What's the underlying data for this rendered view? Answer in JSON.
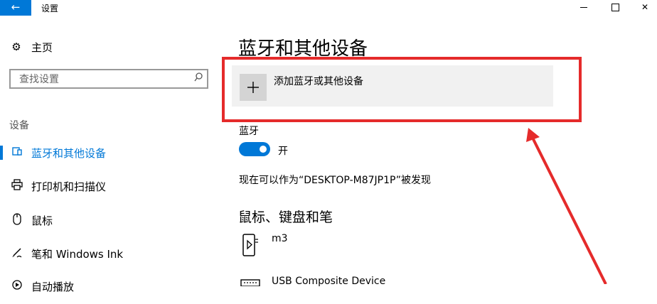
{
  "window": {
    "title": "设置",
    "back_icon": "back-arrow-icon",
    "minimize_icon": "minimize-icon",
    "maximize_icon": "maximize-icon",
    "close_glyph": "✕",
    "accent": "#0078d7"
  },
  "sidebar": {
    "home": {
      "label": "主页",
      "icon": "gear-icon"
    },
    "search": {
      "placeholder": "查找设置",
      "icon": "search-icon"
    },
    "section_label": "设备",
    "items": [
      {
        "label": "蓝牙和其他设备",
        "icon": "bluetooth-devices-icon",
        "active": true
      },
      {
        "label": "打印机和扫描仪",
        "icon": "printer-icon",
        "active": false
      },
      {
        "label": "鼠标",
        "icon": "mouse-icon",
        "active": false
      },
      {
        "label": "笔和 Windows Ink",
        "icon": "pen-icon",
        "active": false
      },
      {
        "label": "自动播放",
        "icon": "autoplay-icon",
        "active": false
      }
    ]
  },
  "main": {
    "title": "蓝牙和其他设备",
    "add_device_label": "添加蓝牙或其他设备",
    "bluetooth": {
      "label": "蓝牙",
      "toggle_state": "开",
      "on": true
    },
    "discoverable_text": "现在可以作为“DESKTOP-M87JP1P”被发现",
    "devices_section_title": "鼠标、键盘和笔",
    "devices": [
      {
        "name": "m3",
        "icon": "phone-device-icon"
      },
      {
        "name": "USB Composite Device",
        "icon": "keyboard-icon"
      }
    ]
  },
  "annotation": {
    "color": "#e52b2b"
  }
}
